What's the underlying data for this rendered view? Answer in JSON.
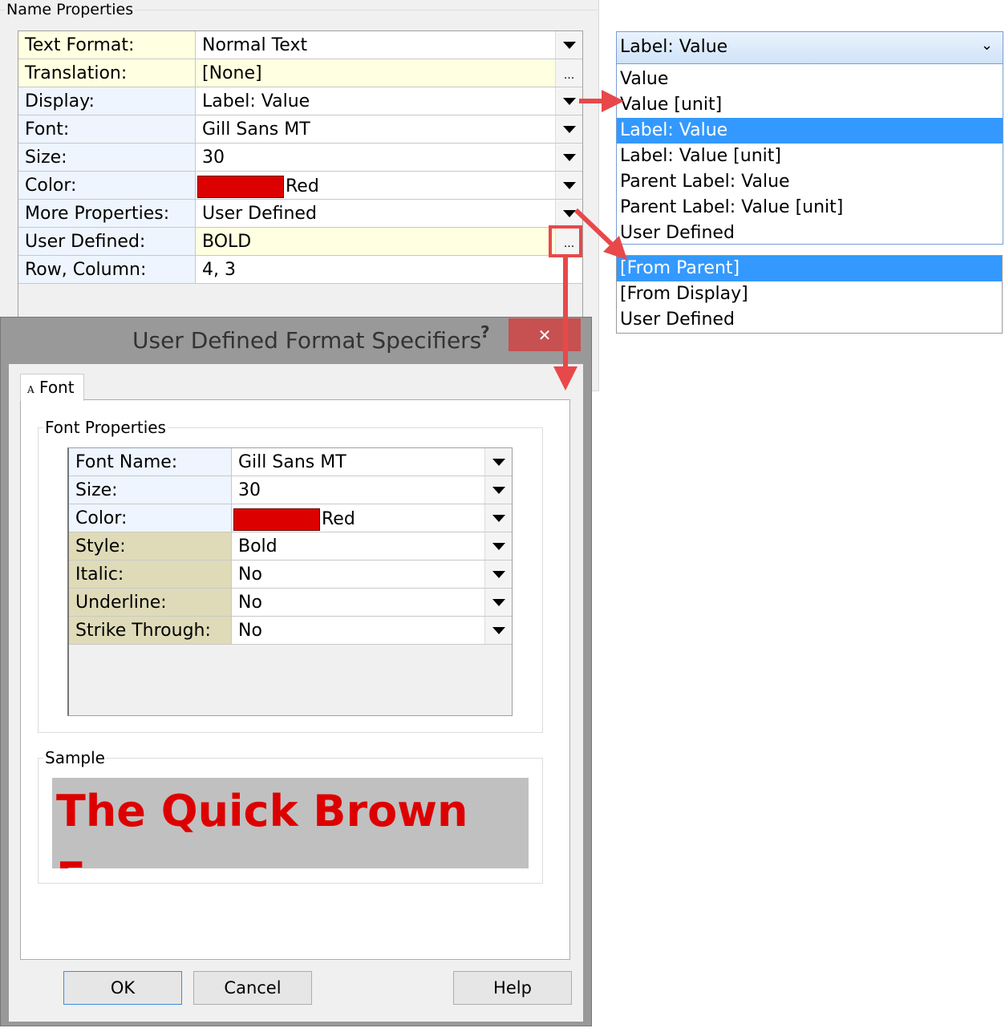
{
  "name_properties": {
    "group_label": "Name Properties",
    "rows": [
      {
        "label": "Text Format:",
        "value": "Normal Text",
        "control": "dropdown"
      },
      {
        "label": "Translation:",
        "value": "[None]",
        "control": "ellipsis"
      },
      {
        "label": "Display:",
        "value": "Label: Value",
        "control": "dropdown"
      },
      {
        "label": "Font:",
        "value": "Gill Sans MT",
        "control": "dropdown"
      },
      {
        "label": "Size:",
        "value": "30",
        "control": "dropdown"
      },
      {
        "label": "Color:",
        "value": "Red",
        "control": "dropdown",
        "swatch": "#dd0000"
      },
      {
        "label": "More Properties:",
        "value": "User Defined",
        "control": "dropdown"
      },
      {
        "label": "User Defined:",
        "value": "BOLD",
        "control": "ellipsis"
      },
      {
        "label": "Row, Column:",
        "value": "4, 3",
        "control": "none"
      }
    ],
    "ellipsis": "..."
  },
  "dialog": {
    "title": "User Defined Format Specifiers",
    "help_glyph": "?",
    "close_glyph": "✕",
    "close_color": "#c75050",
    "tab": {
      "icon": "A",
      "label": "Font"
    },
    "font_group_label": "Font Properties",
    "font_rows": [
      {
        "label": "Font Name:",
        "value": "Gill Sans MT"
      },
      {
        "label": "Size:",
        "value": "30"
      },
      {
        "label": "Color:",
        "value": "Red",
        "swatch": "#dd0000"
      },
      {
        "label": "Style:",
        "value": "Bold"
      },
      {
        "label": "Italic:",
        "value": "No"
      },
      {
        "label": "Underline:",
        "value": "No"
      },
      {
        "label": "Strike Through:",
        "value": "No"
      }
    ],
    "sample_group_label": "Sample",
    "sample_text": "The Quick Brown Fox",
    "sample_color": "#dd0000",
    "buttons": {
      "ok": "OK",
      "cancel": "Cancel",
      "help": "Help"
    }
  },
  "display_dropdown": {
    "selected": "Label: Value",
    "options": [
      "Value",
      "Value [unit]",
      "Label: Value",
      "Label: Value [unit]",
      "Parent Label: Value",
      "Parent Label: Value [unit]",
      "User Defined"
    ],
    "highlighted_index": 2
  },
  "more_properties_dropdown": {
    "options": [
      "[From Parent]",
      "[From Display]",
      "User Defined"
    ],
    "highlighted_index": 0
  },
  "annotation_color": "#e8484a"
}
